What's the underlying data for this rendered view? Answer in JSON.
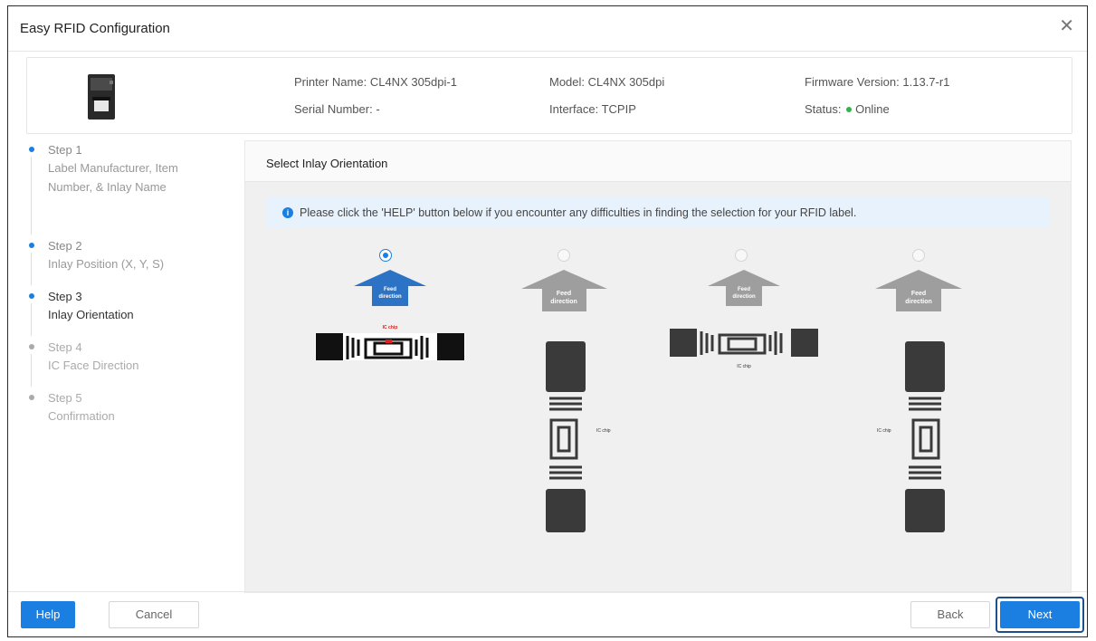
{
  "window": {
    "title": "Easy RFID Configuration",
    "close_icon": "close-icon"
  },
  "printer": {
    "name_label": "Printer Name:",
    "name_value": "CL4NX 305dpi-1",
    "model_label": "Model:",
    "model_value": "CL4NX 305dpi",
    "firmware_label": "Firmware Version:",
    "firmware_value": "1.13.7-r1",
    "serial_label": "Serial Number:",
    "serial_value": "-",
    "interface_label": "Interface:",
    "interface_value": "TCPIP",
    "status_label": "Status:",
    "status_value": "Online",
    "status_color": "#2fb54a"
  },
  "steps": [
    {
      "name": "Step 1",
      "desc": "Label Manufacturer, Item Number, & Inlay Name",
      "state": "done"
    },
    {
      "name": "Step 2",
      "desc": "Inlay Position (X, Y, S)",
      "state": "done"
    },
    {
      "name": "Step 3",
      "desc": "Inlay Orientation",
      "state": "active"
    },
    {
      "name": "Step 4",
      "desc": "IC Face Direction",
      "state": "pending"
    },
    {
      "name": "Step 5",
      "desc": "Confirmation",
      "state": "pending"
    }
  ],
  "panel": {
    "title": "Select Inlay Orientation",
    "notice": "Please click the 'HELP' button below if you encounter any difficulties in finding the selection for your RFID label.",
    "options": [
      {
        "arrow_text_1": "Feed",
        "arrow_text_2": "direction",
        "chip_label": "IC chip",
        "selected": true
      },
      {
        "arrow_text_1": "Feed",
        "arrow_text_2": "direction",
        "chip_label": "IC chip",
        "selected": false
      },
      {
        "arrow_text_1": "Feed",
        "arrow_text_2": "direction",
        "chip_label": "IC chip",
        "selected": false
      },
      {
        "arrow_text_1": "Feed",
        "arrow_text_2": "direction",
        "chip_label": "IC chip",
        "selected": false
      }
    ]
  },
  "footer": {
    "help_label": "Help",
    "cancel_label": "Cancel",
    "back_label": "Back",
    "next_label": "Next"
  },
  "colors": {
    "accent": "#1a7fe0",
    "arrow_gray": "#9e9e9e",
    "inlay_dark": "#3a3a3a"
  }
}
